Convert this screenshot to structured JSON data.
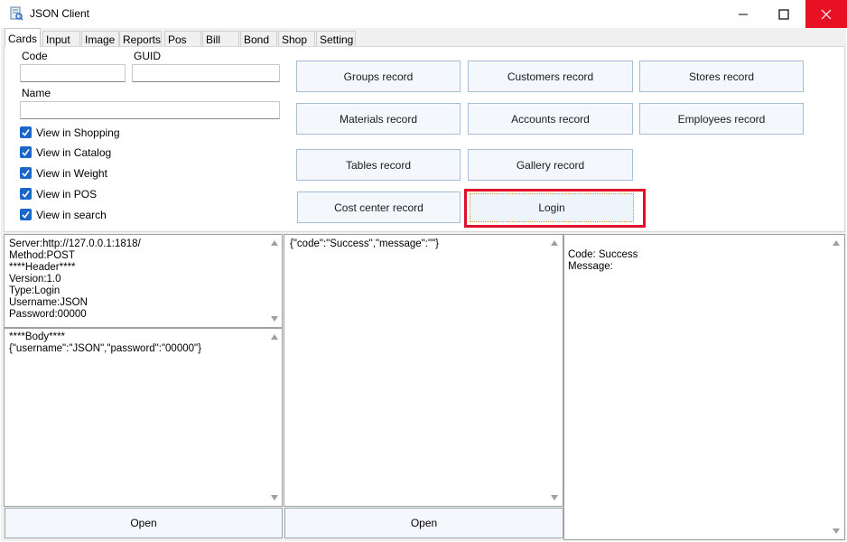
{
  "window": {
    "title": "JSON Client"
  },
  "tabs": [
    "Cards",
    "Input",
    "Image",
    "Reports",
    "Pos",
    "Bill",
    "Bond",
    "Shop",
    "Setting"
  ],
  "form": {
    "code_label": "Code",
    "code_value": "",
    "guid_label": "GUID",
    "guid_value": "",
    "name_label": "Name",
    "name_value": ""
  },
  "checkboxes": [
    {
      "label": "View in Shopping",
      "checked": true
    },
    {
      "label": "View in Catalog",
      "checked": true
    },
    {
      "label": "View in Weight",
      "checked": true
    },
    {
      "label": "View in POS",
      "checked": true
    },
    {
      "label": "View in search",
      "checked": true
    }
  ],
  "buttons": {
    "groups": "Groups record",
    "customers": "Customers record",
    "stores": "Stores record",
    "materials": "Materials record",
    "accounts": "Accounts record",
    "employees": "Employees record",
    "tables": "Tables record",
    "gallery": "Gallery record",
    "cost_center": "Cost center record",
    "login": "Login"
  },
  "request": {
    "header_text": "Server:http://127.0.0.1:1818/\nMethod:POST\n****Header****\nVersion:1.0\nType:Login\nUsername:JSON\nPassword:00000",
    "body_text": "****Body****\n{\"username\":\"JSON\",\"password\":\"00000\"}",
    "open_label": "Open"
  },
  "response": {
    "raw_text": "{\"code\":\"Success\",\"message\":\"\"}",
    "open_label": "Open"
  },
  "result": {
    "text": "Code: Success\nMessage:"
  },
  "colors": {
    "accent": "#1a67c9",
    "close_button": "#e81123",
    "highlight": "#e0102c"
  }
}
